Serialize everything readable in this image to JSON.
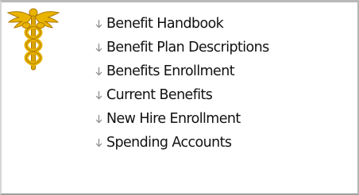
{
  "logo": {
    "icon": "caduceus-icon",
    "gold_color": "#e8b400",
    "shade_color": "#b07a00"
  },
  "menu": {
    "arrow_icon": "down-arrow-icon",
    "arrow_color": "#888888",
    "text_color": "#111111",
    "items": [
      {
        "label": "Benefit Handbook"
      },
      {
        "label": "Benefit Plan Descriptions"
      },
      {
        "label": "Benefits Enrollment"
      },
      {
        "label": "Current Benefits"
      },
      {
        "label": "New Hire Enrollment"
      },
      {
        "label": "Spending Accounts"
      }
    ]
  }
}
